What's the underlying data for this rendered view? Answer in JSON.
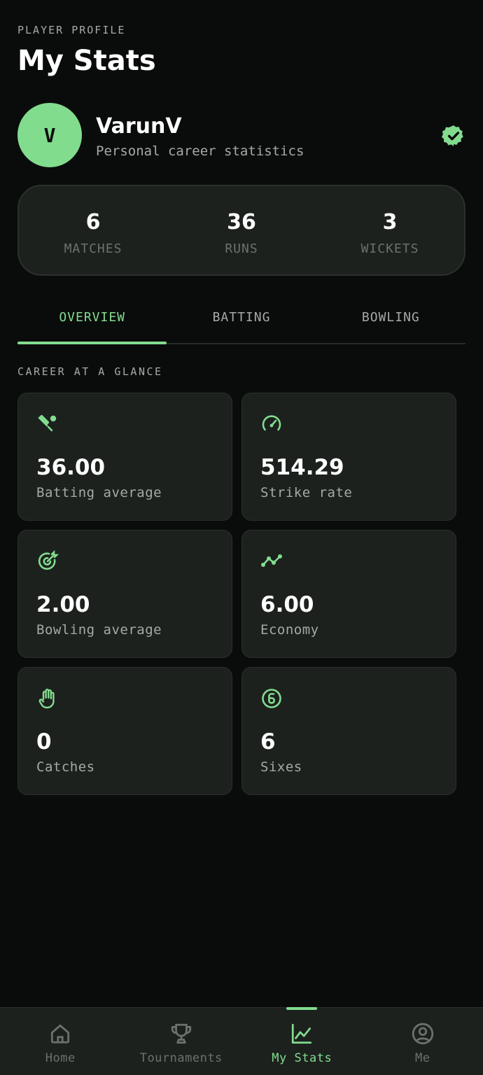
{
  "header": {
    "eyebrow": "PLAYER PROFILE",
    "title": "My Stats"
  },
  "profile": {
    "avatar_initial": "V",
    "name": "VarunV",
    "subtitle": "Personal career statistics",
    "verified_icon": "verified-badge-icon"
  },
  "summary": [
    {
      "value": "6",
      "label": "MATCHES"
    },
    {
      "value": "36",
      "label": "RUNS"
    },
    {
      "value": "3",
      "label": "WICKETS"
    }
  ],
  "tabs": [
    {
      "label": "OVERVIEW",
      "active": true
    },
    {
      "label": "BATTING",
      "active": false
    },
    {
      "label": "BOWLING",
      "active": false
    }
  ],
  "section": {
    "label": "CAREER AT A GLANCE"
  },
  "stats": [
    {
      "icon": "cricket-bat-icon",
      "value": "36.00",
      "label": "Batting average"
    },
    {
      "icon": "speedometer-icon",
      "value": "514.29",
      "label": "Strike rate"
    },
    {
      "icon": "target-icon",
      "value": "2.00",
      "label": "Bowling average"
    },
    {
      "icon": "trend-line-icon",
      "value": "6.00",
      "label": "Economy"
    },
    {
      "icon": "hand-icon",
      "value": "0",
      "label": "Catches"
    },
    {
      "icon": "six-circle-icon",
      "value": "6",
      "label": "Sixes"
    }
  ],
  "nav": [
    {
      "icon": "home-icon",
      "label": "Home",
      "active": false
    },
    {
      "icon": "trophy-icon",
      "label": "Tournaments",
      "active": false
    },
    {
      "icon": "chart-icon",
      "label": "My Stats",
      "active": true
    },
    {
      "icon": "user-circle-icon",
      "label": "Me",
      "active": false
    }
  ],
  "colors": {
    "background": "#0a0c0b",
    "surface": "#1c211e",
    "accent": "#82dc8e",
    "muted_text": "#a6aaa7",
    "dim_text": "#6c716e"
  }
}
